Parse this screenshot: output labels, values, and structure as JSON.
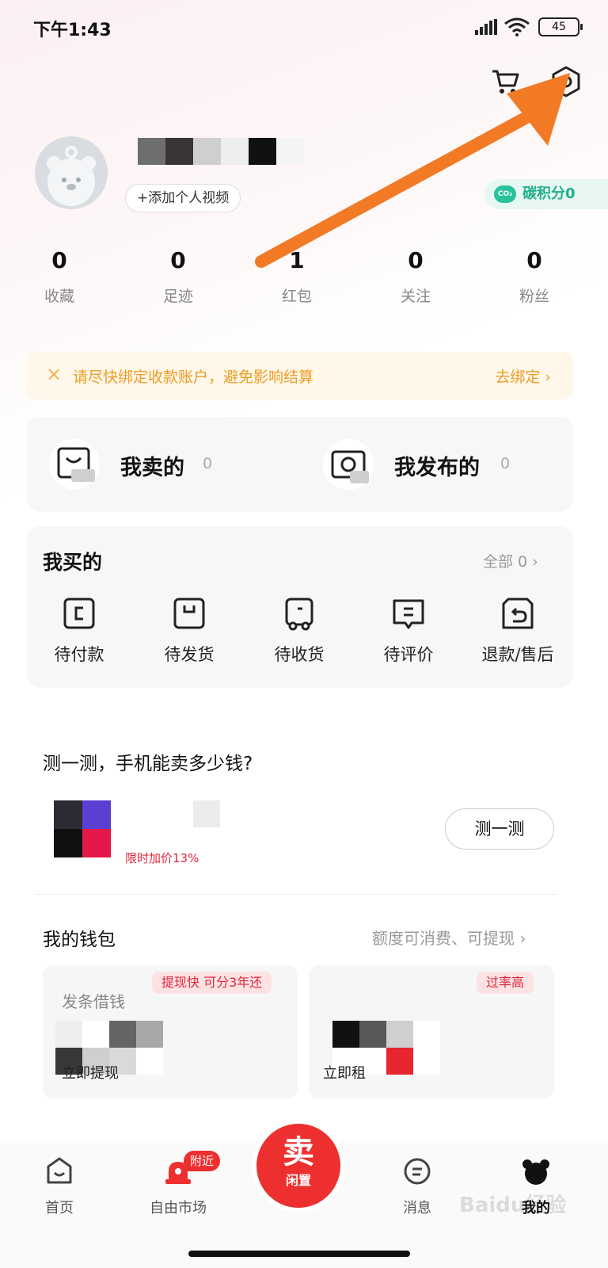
{
  "status": {
    "time": "下午1:43",
    "battery": "45"
  },
  "profile": {
    "add_video": "+添加个人视频",
    "carbon": "碳积分0",
    "co2": "CO₂"
  },
  "stats": [
    {
      "value": "0",
      "label": "收藏"
    },
    {
      "value": "0",
      "label": "足迹"
    },
    {
      "value": "1",
      "label": "红包"
    },
    {
      "value": "0",
      "label": "关注"
    },
    {
      "value": "0",
      "label": "粉丝"
    }
  ],
  "notice": {
    "close": "×",
    "text": "请尽快绑定收款账户，避免影响结算",
    "action": "去绑定 ›"
  },
  "sell_card": {
    "sold_label": "我卖的",
    "sold_count": "0",
    "published_label": "我发布的",
    "published_count": "0"
  },
  "buy": {
    "title": "我买的",
    "all": "全部 0 ›",
    "orders": [
      "待付款",
      "待发货",
      "待收货",
      "待评价",
      "退款/售后"
    ]
  },
  "phone_test": {
    "question": "测一测，手机能卖多少钱?",
    "promo": "限时加价13%",
    "button": "测一测"
  },
  "wallet": {
    "title": "我的钱包",
    "more": "额度可消费、可提现 ›",
    "tag1": "提现快 可分3年还",
    "tag2": "过率高",
    "loan_label": "发条借钱",
    "action1": "立即提现",
    "action2": "立即租"
  },
  "nav": {
    "home": "首页",
    "market": "自由市场",
    "market_badge": "附近",
    "sell_main": "卖",
    "sell_sub": "闲置",
    "messages": "消息",
    "mine": "我的"
  },
  "watermark": "Baidu经验",
  "colors": {
    "accent_red": "#ee2f2f",
    "notice_orange": "#ee9c25",
    "carbon_green": "#1fb08a",
    "arrow_orange": "#f27a25"
  }
}
